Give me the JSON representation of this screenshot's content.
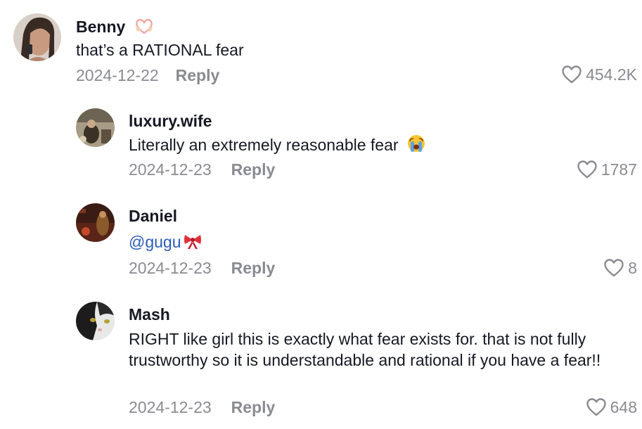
{
  "comments": [
    {
      "username": "Benny",
      "username_emoji": "heart-hands-icon",
      "text": "that’s a RATIONAL fear",
      "date": "2024-12-22",
      "reply_label": "Reply",
      "likes": "454.2K"
    },
    {
      "username": "luxury.wife",
      "text": "Literally an extremely reasonable fear",
      "text_emoji": "crying-face-icon",
      "date": "2024-12-23",
      "reply_label": "Reply",
      "likes": "1787"
    },
    {
      "username": "Daniel",
      "mention": "@gugu",
      "text_emoji": "ribbon-bow-icon",
      "date": "2024-12-23",
      "reply_label": "Reply",
      "likes": "8"
    },
    {
      "username": "Mash",
      "text": "RIGHT like girl this is exactly what fear exists for. that is not fully trustworthy so it is understandable and rational if you have a fear!!",
      "date": "2024-12-23",
      "reply_label": "Reply",
      "likes": "648"
    }
  ],
  "colors": {
    "text": "#161823",
    "secondary": "#8a8b91",
    "mention": "#2b5db9"
  }
}
